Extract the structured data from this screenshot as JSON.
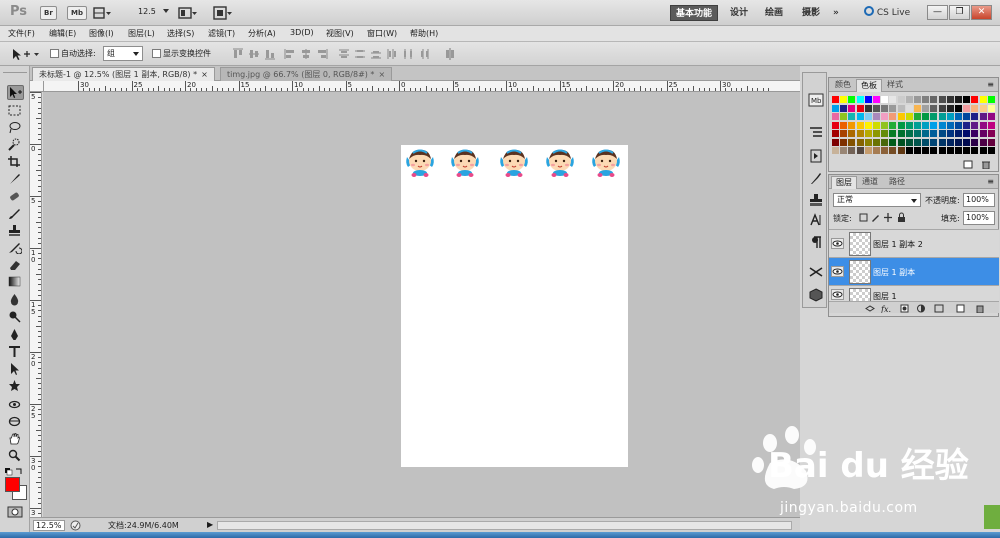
{
  "app": {
    "logo": "Ps",
    "chips": [
      "Br",
      "Mb"
    ],
    "zoom": "12.5",
    "workspaces": [
      "基本功能",
      "设计",
      "绘画",
      "摄影"
    ],
    "more": "»",
    "cslive": "CS Live",
    "win": [
      "—",
      "❐",
      "✕"
    ]
  },
  "menu": [
    "文件(F)",
    "编辑(E)",
    "图像(I)",
    "图层(L)",
    "选择(S)",
    "滤镜(T)",
    "分析(A)",
    "3D(D)",
    "视图(V)",
    "窗口(W)",
    "帮助(H)"
  ],
  "options": {
    "auto_select_label": "自动选择:",
    "auto_select_value": "组",
    "show_transform_label": "显示变换控件"
  },
  "tabs": [
    {
      "title": "未标题-1 @ 12.5% (图层 1 副本, RGB/8) *",
      "close": "×"
    },
    {
      "title": "timg.jpg @ 66.7% (图层 0, RGB/8#) *",
      "close": "×"
    }
  ],
  "ruler": {
    "h_labels": [
      "30",
      "25",
      "20",
      "15",
      "10",
      "5",
      "0",
      "5",
      "10",
      "15",
      "20",
      "25",
      "30"
    ],
    "v_labels": [
      "5",
      "0",
      "5",
      "1 0",
      "1 5",
      "2 0",
      "2 5",
      "3 0",
      "3 5"
    ]
  },
  "status": {
    "zoom": "12.5%",
    "doc": "文档:24.9M/6.40M",
    "arrow": "▶"
  },
  "swatches_panel": {
    "tabs": [
      "颜色",
      "色板",
      "样式"
    ],
    "colors": [
      [
        "#ff0000",
        "#ffff00",
        "#00ff00",
        "#00ffff",
        "#0000ff",
        "#ff00ff",
        "#ffffff",
        "#e6e6e6",
        "#cccccc",
        "#b3b3b3",
        "#999999",
        "#808080",
        "#666666",
        "#4d4d4d",
        "#333333",
        "#1a1a1a",
        "#000000",
        "#ff0000",
        "#ffff00",
        "#00ff00"
      ],
      [
        "#00a0e9",
        "#1d2088",
        "#e4007f",
        "#e60012",
        "#333333",
        "#555555",
        "#777777",
        "#999999",
        "#bbbbbb",
        "#dddddd",
        "#f8b551",
        "#a0a0a0",
        "#606060",
        "#404040",
        "#202020",
        "#000000",
        "#f29c9f",
        "#f6b37f",
        "#facd89",
        "#ffff99"
      ],
      [
        "#ea68a2",
        "#8fc31f",
        "#13b5b1",
        "#00b7ee",
        "#7ecef4",
        "#aa89bd",
        "#f19ec2",
        "#f29b76",
        "#fcc800",
        "#cfdb00",
        "#22ac38",
        "#009944",
        "#009b6b",
        "#009e96",
        "#00a0c1",
        "#0068b7",
        "#00479d",
        "#1d2088",
        "#601986",
        "#920783"
      ],
      [
        "#e60012",
        "#eb6100",
        "#f39800",
        "#fcc800",
        "#fff100",
        "#cfdb00",
        "#8fc31f",
        "#22ac38",
        "#009944",
        "#009b6b",
        "#009e96",
        "#00a0c1",
        "#00a0e9",
        "#0086d1",
        "#0068b7",
        "#00479d",
        "#1d2088",
        "#601986",
        "#920783",
        "#be0081"
      ],
      [
        "#a40000",
        "#a84200",
        "#ac6a00",
        "#b28500",
        "#b7aa00",
        "#8d9800",
        "#638c0b",
        "#097c25",
        "#007130",
        "#00704a",
        "#007167",
        "#00698c",
        "#005e9a",
        "#004986",
        "#003380",
        "#001b6b",
        "#000b6b",
        "#3c0062",
        "#660062",
        "#850055"
      ],
      [
        "#7d0000",
        "#7e3000",
        "#825100",
        "#866300",
        "#8a8000",
        "#6a7300",
        "#48680b",
        "#005c1a",
        "#005222",
        "#005337",
        "#00554d",
        "#004e6a",
        "#004575",
        "#003567",
        "#002460",
        "#001451",
        "#000a4f",
        "#2b0048",
        "#4d0046",
        "#63003d"
      ],
      [
        "#c7b299",
        "#998675",
        "#736357",
        "#534741",
        "#c69c6d",
        "#a67c52",
        "#8c6239",
        "#754c24",
        "#603813",
        "#000000",
        "#000000",
        "#000000",
        "#000000",
        "#000000",
        "#000000",
        "#000000",
        "#000000",
        "#000000",
        "#000000",
        "#000000"
      ]
    ]
  },
  "layers_panel": {
    "tabs": [
      "图层",
      "通道",
      "路径"
    ],
    "blend": "正常",
    "opacity_label": "不透明度:",
    "opacity": "100%",
    "lock_label": "锁定:",
    "fill_label": "填充:",
    "fill": "100%",
    "layers": [
      {
        "name": "图层 1 副本 2",
        "selected": false
      },
      {
        "name": "图层 1 副本",
        "selected": true
      },
      {
        "name": "图层 1",
        "selected": false
      }
    ],
    "footer": "fx."
  },
  "watermark": {
    "brand": "Bai du 经验",
    "url": "jingyan.baidu.com"
  }
}
